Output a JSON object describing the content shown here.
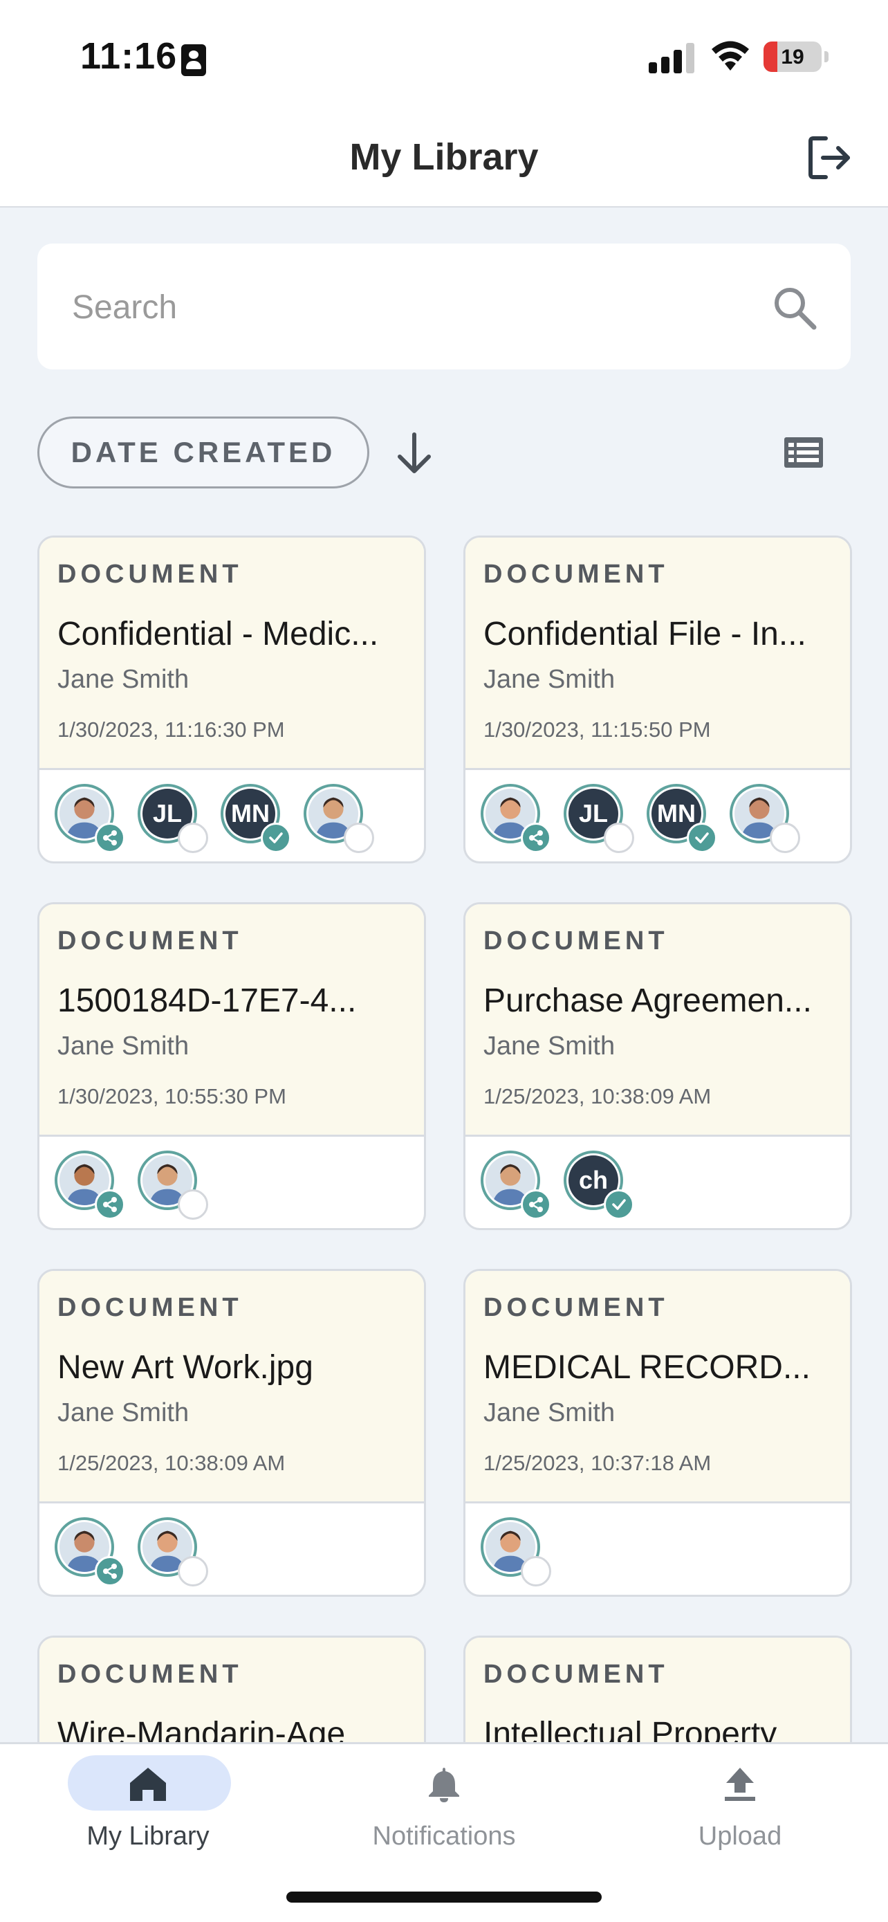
{
  "status_bar": {
    "time": "11:16",
    "battery": "19"
  },
  "header": {
    "title": "My Library"
  },
  "search": {
    "placeholder": "Search"
  },
  "sort": {
    "label": "DATE CREATED"
  },
  "cards": [
    {
      "type": "DOCUMENT",
      "title": "Confidential - Medic...",
      "owner": "Jane Smith",
      "date": "1/30/2023, 11:16:30 PM",
      "avatars": [
        {
          "kind": "photo",
          "status": "share"
        },
        {
          "kind": "initials",
          "text": "JL",
          "status": "pending"
        },
        {
          "kind": "initials",
          "text": "MN",
          "status": "check"
        },
        {
          "kind": "photo",
          "status": "pending"
        }
      ]
    },
    {
      "type": "DOCUMENT",
      "title": "Confidential File - In...",
      "owner": "Jane Smith",
      "date": "1/30/2023, 11:15:50 PM",
      "avatars": [
        {
          "kind": "photo",
          "status": "share"
        },
        {
          "kind": "initials",
          "text": "JL",
          "status": "pending"
        },
        {
          "kind": "initials",
          "text": "MN",
          "status": "check"
        },
        {
          "kind": "photo",
          "status": "pending"
        }
      ]
    },
    {
      "type": "DOCUMENT",
      "title": "1500184D-17E7-4...",
      "owner": "Jane Smith",
      "date": "1/30/2023, 10:55:30 PM",
      "avatars": [
        {
          "kind": "photo",
          "status": "share"
        },
        {
          "kind": "photo",
          "status": "pending"
        }
      ]
    },
    {
      "type": "DOCUMENT",
      "title": "Purchase Agreemen...",
      "owner": "Jane Smith",
      "date": "1/25/2023, 10:38:09 AM",
      "avatars": [
        {
          "kind": "photo",
          "status": "share"
        },
        {
          "kind": "initials",
          "text": "ch",
          "status": "check"
        }
      ]
    },
    {
      "type": "DOCUMENT",
      "title": "New Art Work.jpg",
      "owner": "Jane Smith",
      "date": "1/25/2023, 10:38:09 AM",
      "avatars": [
        {
          "kind": "photo",
          "status": "share"
        },
        {
          "kind": "photo",
          "status": "pending"
        }
      ]
    },
    {
      "type": "DOCUMENT",
      "title": "MEDICAL RECORD...",
      "owner": "Jane Smith",
      "date": "1/25/2023, 10:37:18 AM",
      "avatars": [
        {
          "kind": "photo",
          "status": "pending"
        }
      ]
    },
    {
      "type": "DOCUMENT",
      "title": "Wire-Mandarin-Age",
      "owner": "",
      "date": "",
      "avatars": []
    },
    {
      "type": "DOCUMENT",
      "title": "Intellectual Property",
      "owner": "",
      "date": "",
      "avatars": []
    }
  ],
  "nav": {
    "items": [
      {
        "label": "My Library",
        "icon": "home-icon",
        "active": true
      },
      {
        "label": "Notifications",
        "icon": "bell-icon",
        "active": false
      },
      {
        "label": "Upload",
        "icon": "upload-icon",
        "active": false
      }
    ]
  },
  "colors": {
    "accent": "#4e9c97",
    "card_top": "#fbf9ec",
    "page_bg": "#eff3f8",
    "active_pill": "#dbe6fb"
  }
}
